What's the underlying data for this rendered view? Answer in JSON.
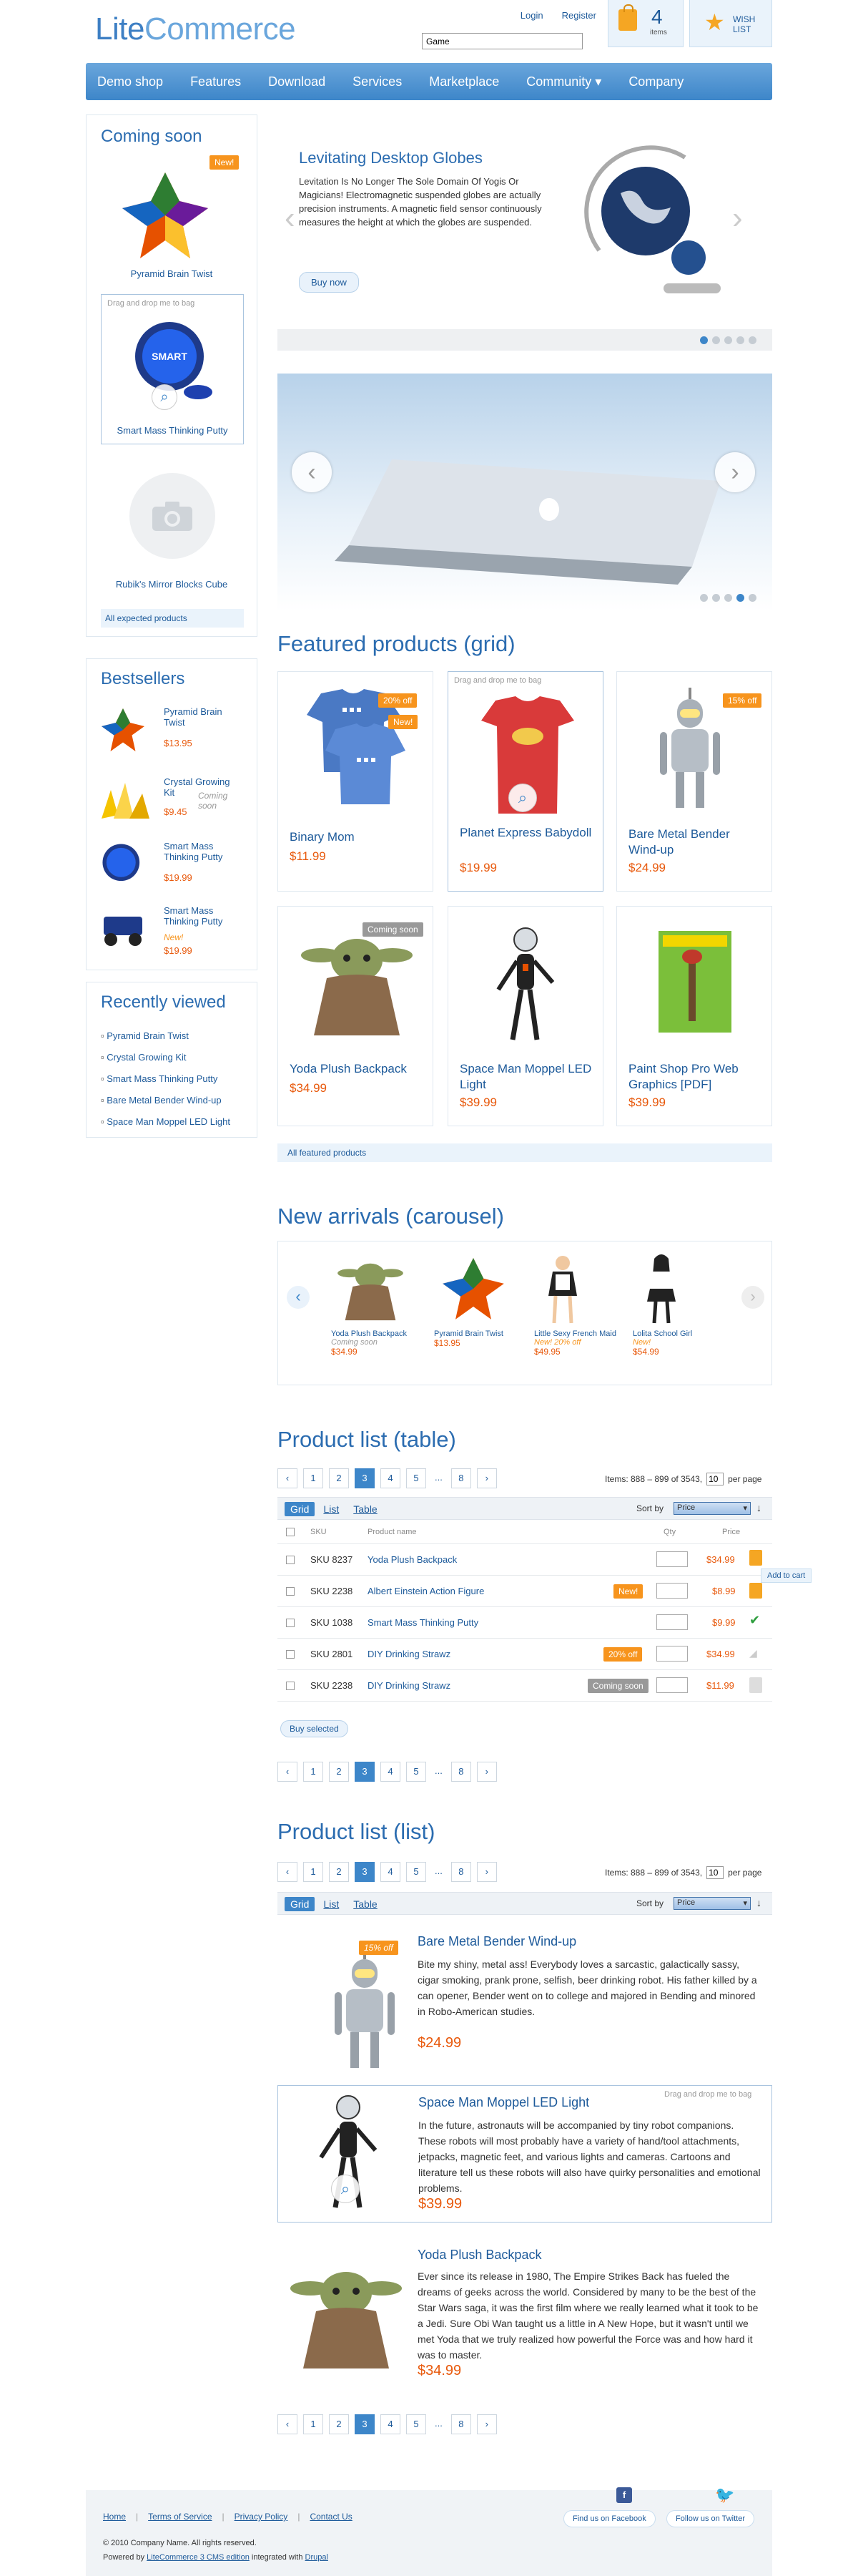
{
  "header": {
    "logo_part1": "Lite",
    "logo_part2": "Commerce",
    "login": "Login",
    "register": "Register",
    "search_value": "Game",
    "cart_count": "4",
    "cart_label": "items",
    "wish_label_1": "WISH",
    "wish_label_2": "LIST"
  },
  "nav": [
    "Demo shop",
    "Features",
    "Download",
    "Services",
    "Marketplace",
    "Community ▾",
    "Company"
  ],
  "coming_soon": {
    "title": "Coming soon",
    "badge": "New!",
    "items": [
      "Pyramid Brain Twist",
      "Smart Mass Thinking Putty",
      "Rubik's Mirror Blocks Cube"
    ],
    "drag_hint": "Drag and drop me to bag",
    "all_link": "All expected products"
  },
  "bestsellers": {
    "title": "Bestsellers",
    "items": [
      {
        "name": "Pyramid Brain Twist",
        "price": "$13.95",
        "note": ""
      },
      {
        "name": "Crystal Growing Kit",
        "price": "$9.45",
        "note": "Coming soon"
      },
      {
        "name": "Smart Mass Thinking Putty",
        "price": "$19.99",
        "note": ""
      },
      {
        "name": "Smart Mass Thinking Putty",
        "price": "$19.99",
        "note": "New!"
      }
    ]
  },
  "recently_viewed": {
    "title": "Recently viewed",
    "items": [
      "Pyramid Brain Twist",
      "Crystal Growing Kit",
      "Smart Mass Thinking Putty",
      "Bare Metal Bender Wind-up",
      "Space Man Moppel LED Light"
    ]
  },
  "slider": {
    "title": "Levitating Desktop Globes",
    "text": "Levitation Is No Longer The Sole Domain Of Yogis Or Magicians! Electromagnetic suspended globes are actually precision instruments. A magnetic field sensor continuously measures the height at which the globes are suspended.",
    "button": "Buy now"
  },
  "featured": {
    "title": "Featured products (grid)",
    "drag_hint": "Drag and drop me to bag",
    "products": [
      {
        "name": "Binary Mom",
        "price": "$11.99",
        "badge1": "20% off",
        "badge2": "New!"
      },
      {
        "name": "Planet Express Babydoll",
        "price": "$19.99",
        "badge1": "",
        "badge2": ""
      },
      {
        "name": "Bare Metal Bender Wind-up",
        "price": "$24.99",
        "badge1": "15% off",
        "badge2": ""
      },
      {
        "name": "Yoda Plush Backpack",
        "price": "$34.99",
        "badge1": "Coming soon",
        "badge2": ""
      },
      {
        "name": "Space Man Moppel LED Light",
        "price": "$39.99",
        "badge1": "",
        "badge2": ""
      },
      {
        "name": "Paint Shop Pro Web Graphics [PDF]",
        "price": "$39.99",
        "badge1": "",
        "badge2": ""
      }
    ],
    "all_link": "All featured products"
  },
  "carousel": {
    "title": "New arrivals (carousel)",
    "items": [
      {
        "name": "Yoda Plush Backpack",
        "note": "Coming soon",
        "price": "$34.99"
      },
      {
        "name": "Pyramid Brain Twist",
        "note": "",
        "price": "$13.95"
      },
      {
        "name": "Little Sexy French Maid",
        "note": "New! 20% off",
        "price": "$49.95"
      },
      {
        "name": "Lolita School Girl",
        "note": "New!",
        "price": "$54.99"
      }
    ]
  },
  "table_list": {
    "title": "Product list (table)",
    "pages": [
      "‹",
      "1",
      "2",
      "3",
      "4",
      "5",
      "...",
      "8",
      "›"
    ],
    "items_text": "Items: 888 – 899 of 3543,",
    "per_page_value": "10",
    "per_page_label": "per page",
    "tabs": [
      "Grid",
      "List",
      "Table"
    ],
    "sort_label": "Sort by",
    "sort_value": "Price",
    "col_sku": "SKU",
    "col_name": "Product name",
    "col_qty": "Qty",
    "col_price": "Price",
    "rows": [
      {
        "sku": "SKU 8237",
        "name": "Yoda Plush Backpack",
        "badge": "",
        "price": "$34.99"
      },
      {
        "sku": "SKU 2238",
        "name": "Albert Einstein Action Figure",
        "badge": "New!",
        "price": "$8.99"
      },
      {
        "sku": "SKU 1038",
        "name": "Smart Mass Thinking Putty",
        "badge": "",
        "price": "$9.99"
      },
      {
        "sku": "SKU 2801",
        "name": "DIY Drinking Strawz",
        "badge": "20% off",
        "price": "$34.99"
      },
      {
        "sku": "SKU 2238",
        "name": "DIY Drinking Strawz",
        "badge": "Coming soon",
        "price": "$11.99"
      }
    ],
    "add_to_cart": "Add to cart",
    "buy_selected": "Buy selected"
  },
  "list_list": {
    "title": "Product list (list)",
    "drag_hint": "Drag and drop me to bag",
    "items": [
      {
        "name": "Bare Metal Bender Wind-up",
        "badge": "15% off",
        "desc": "Bite my shiny, metal ass! Everybody loves a sarcastic, galactically sassy, cigar smoking, prank prone, selfish, beer drinking robot. His father killed by a can opener, Bender went on to college and majored in Bending and minored in Robo-American studies.",
        "price": "$24.99"
      },
      {
        "name": "Space Man Moppel LED Light",
        "badge": "",
        "desc": "In the future, astronauts will be accompanied by tiny robot companions. These robots will most probably have a variety of hand/tool attachments, jetpacks, magnetic feet, and various lights and cameras. Cartoons and literature tell us these robots will also have quirky personalities and emotional problems.",
        "price": "$39.99"
      },
      {
        "name": "Yoda Plush Backpack",
        "badge": "",
        "desc": "Ever since its release in 1980, The Empire Strikes Back has fueled the dreams of geeks across the world. Considered by many to be the best of the Star Wars saga, it was the first film where we really learned what it took to be a Jedi. Sure Obi Wan taught us a little in A New Hope, but it wasn't until we met Yoda that we truly realized how powerful the Force was and how hard it was to master.",
        "price": "$34.99"
      }
    ]
  },
  "footer": {
    "links": [
      "Home",
      "Terms of Service",
      "Privacy Policy",
      "Contact Us"
    ],
    "copyright": "© 2010 Company Name. All rights reserved.",
    "powered_prefix": "Powered by",
    "powered_link": "LiteCommerce 3 CMS edition",
    "integrated": "integrated with",
    "drupal": "Drupal",
    "facebook": "Find us on Facebook",
    "twitter": "Follow us on Twitter"
  }
}
